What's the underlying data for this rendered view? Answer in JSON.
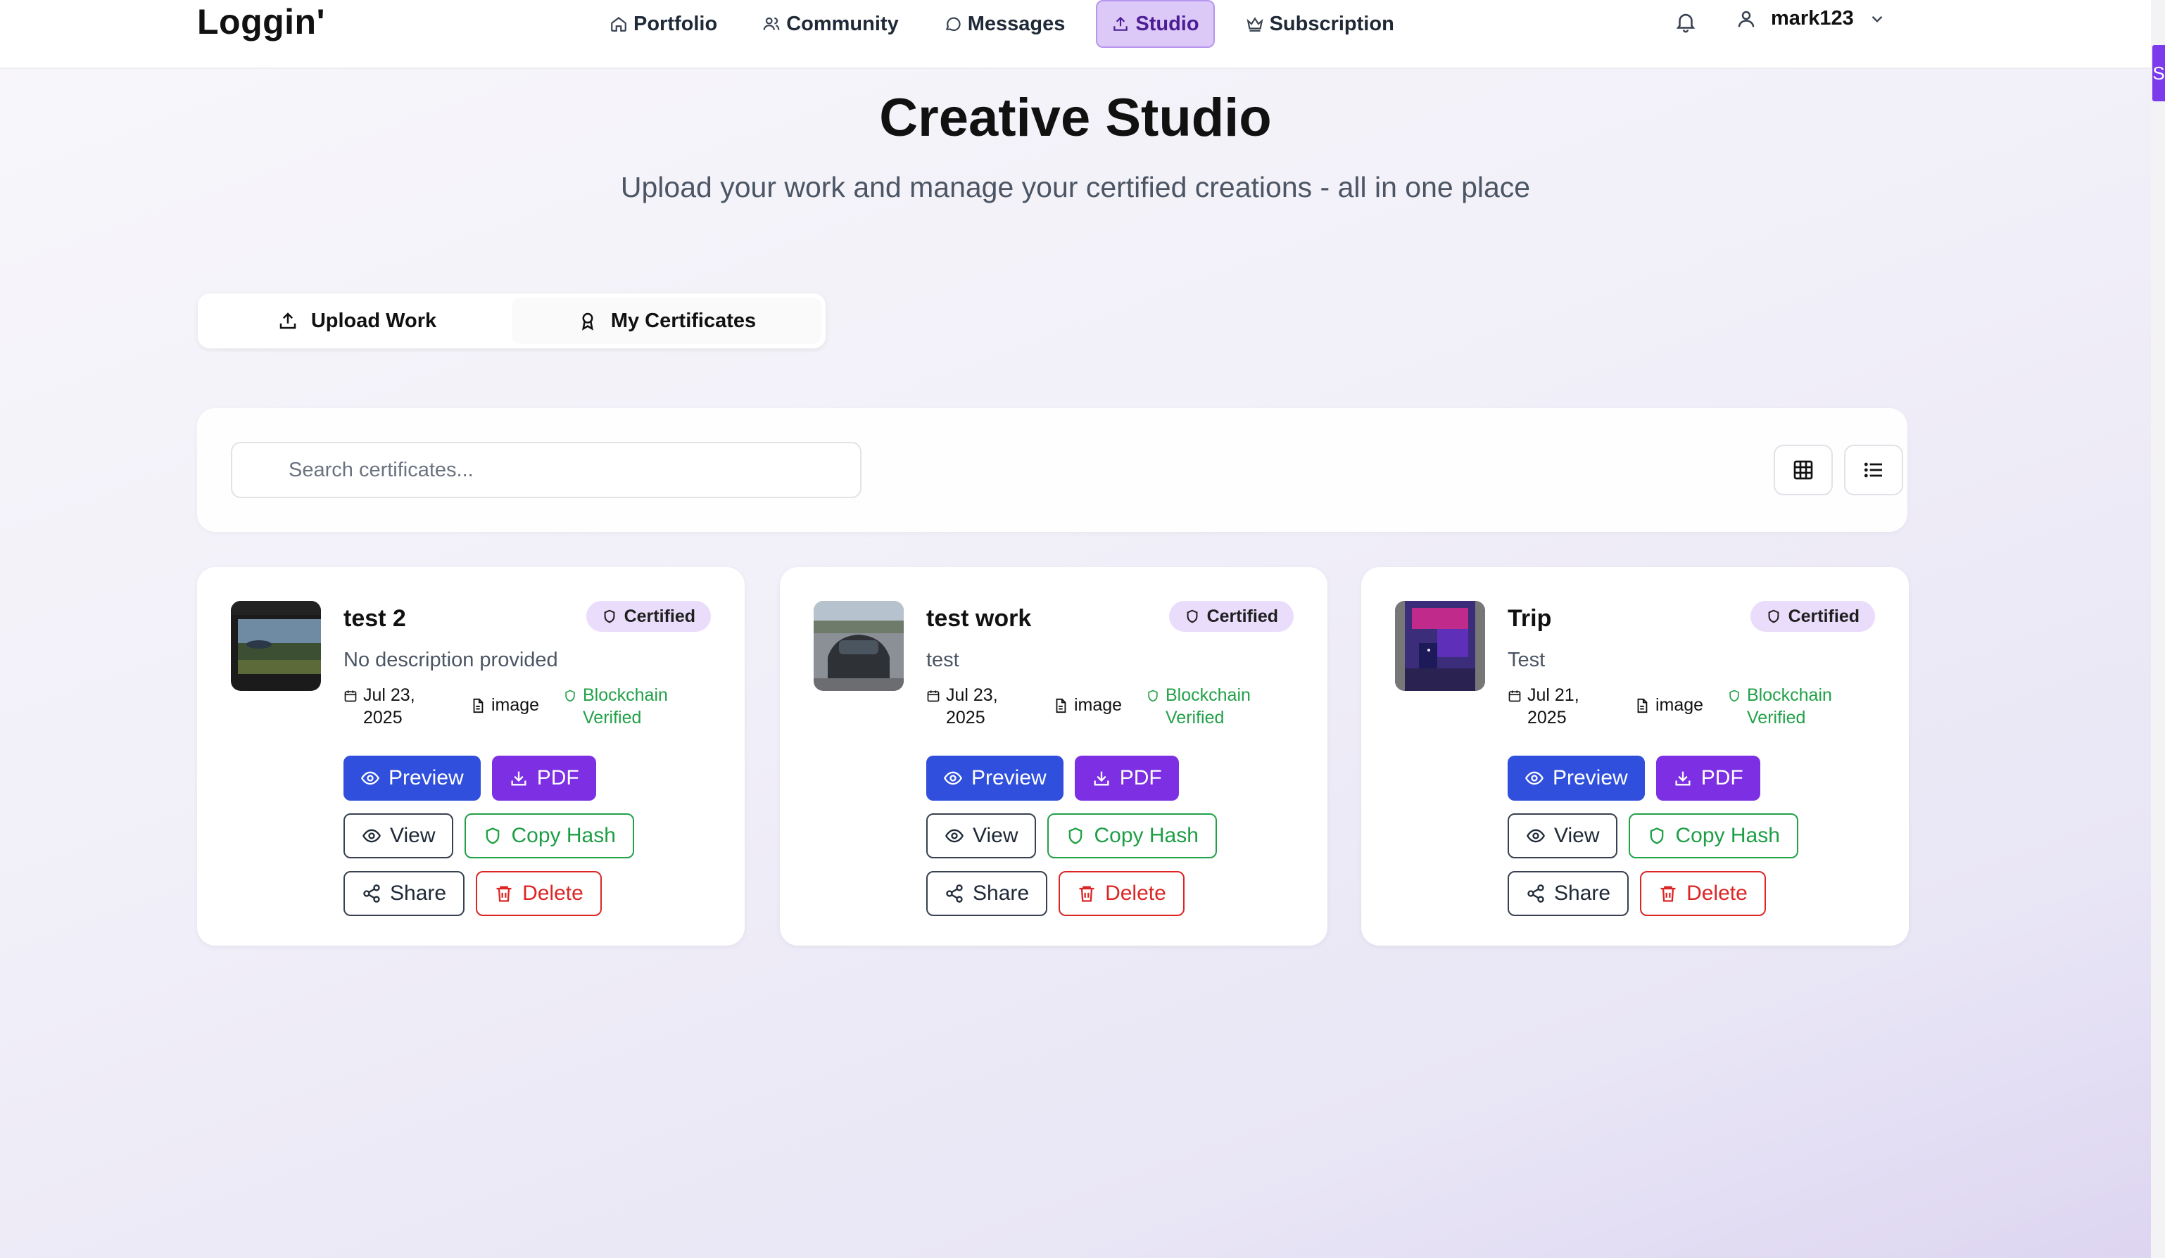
{
  "app": {
    "logo": "Loggin'"
  },
  "nav": {
    "items": [
      {
        "label": "Portfolio",
        "icon": "home-icon"
      },
      {
        "label": "Community",
        "icon": "users-icon"
      },
      {
        "label": "Messages",
        "icon": "message-icon"
      },
      {
        "label": "Studio",
        "icon": "upload-icon",
        "active": true
      },
      {
        "label": "Subscription",
        "icon": "crown-icon"
      }
    ]
  },
  "user": {
    "name": "mark123"
  },
  "scrollbar_label": "S",
  "hero": {
    "title": "Creative Studio",
    "subtitle": "Upload your work and manage your certified creations - all in one place"
  },
  "tabs": [
    {
      "label": "Upload Work",
      "icon": "upload-icon"
    },
    {
      "label": "My Certificates",
      "icon": "award-icon",
      "active": true
    }
  ],
  "search": {
    "placeholder": "Search certificates...",
    "value": ""
  },
  "badge_label": "Certified",
  "verified_label": "Blockchain Verified",
  "buttons": {
    "preview": "Preview",
    "pdf": "PDF",
    "view": "View",
    "copy_hash": "Copy Hash",
    "share": "Share",
    "delete": "Delete"
  },
  "certificates": [
    {
      "title": "test 2",
      "description": "No description provided",
      "date": "Jul 23, 2025",
      "type": "image"
    },
    {
      "title": "test work",
      "description": "test",
      "date": "Jul 23, 2025",
      "type": "image"
    },
    {
      "title": "Trip",
      "description": "Test",
      "date": "Jul 21, 2025",
      "type": "image"
    }
  ],
  "colors": {
    "accent": "#7c3aed",
    "primary": "#2f4fdc",
    "verified": "#22a148",
    "danger": "#dc2626"
  }
}
